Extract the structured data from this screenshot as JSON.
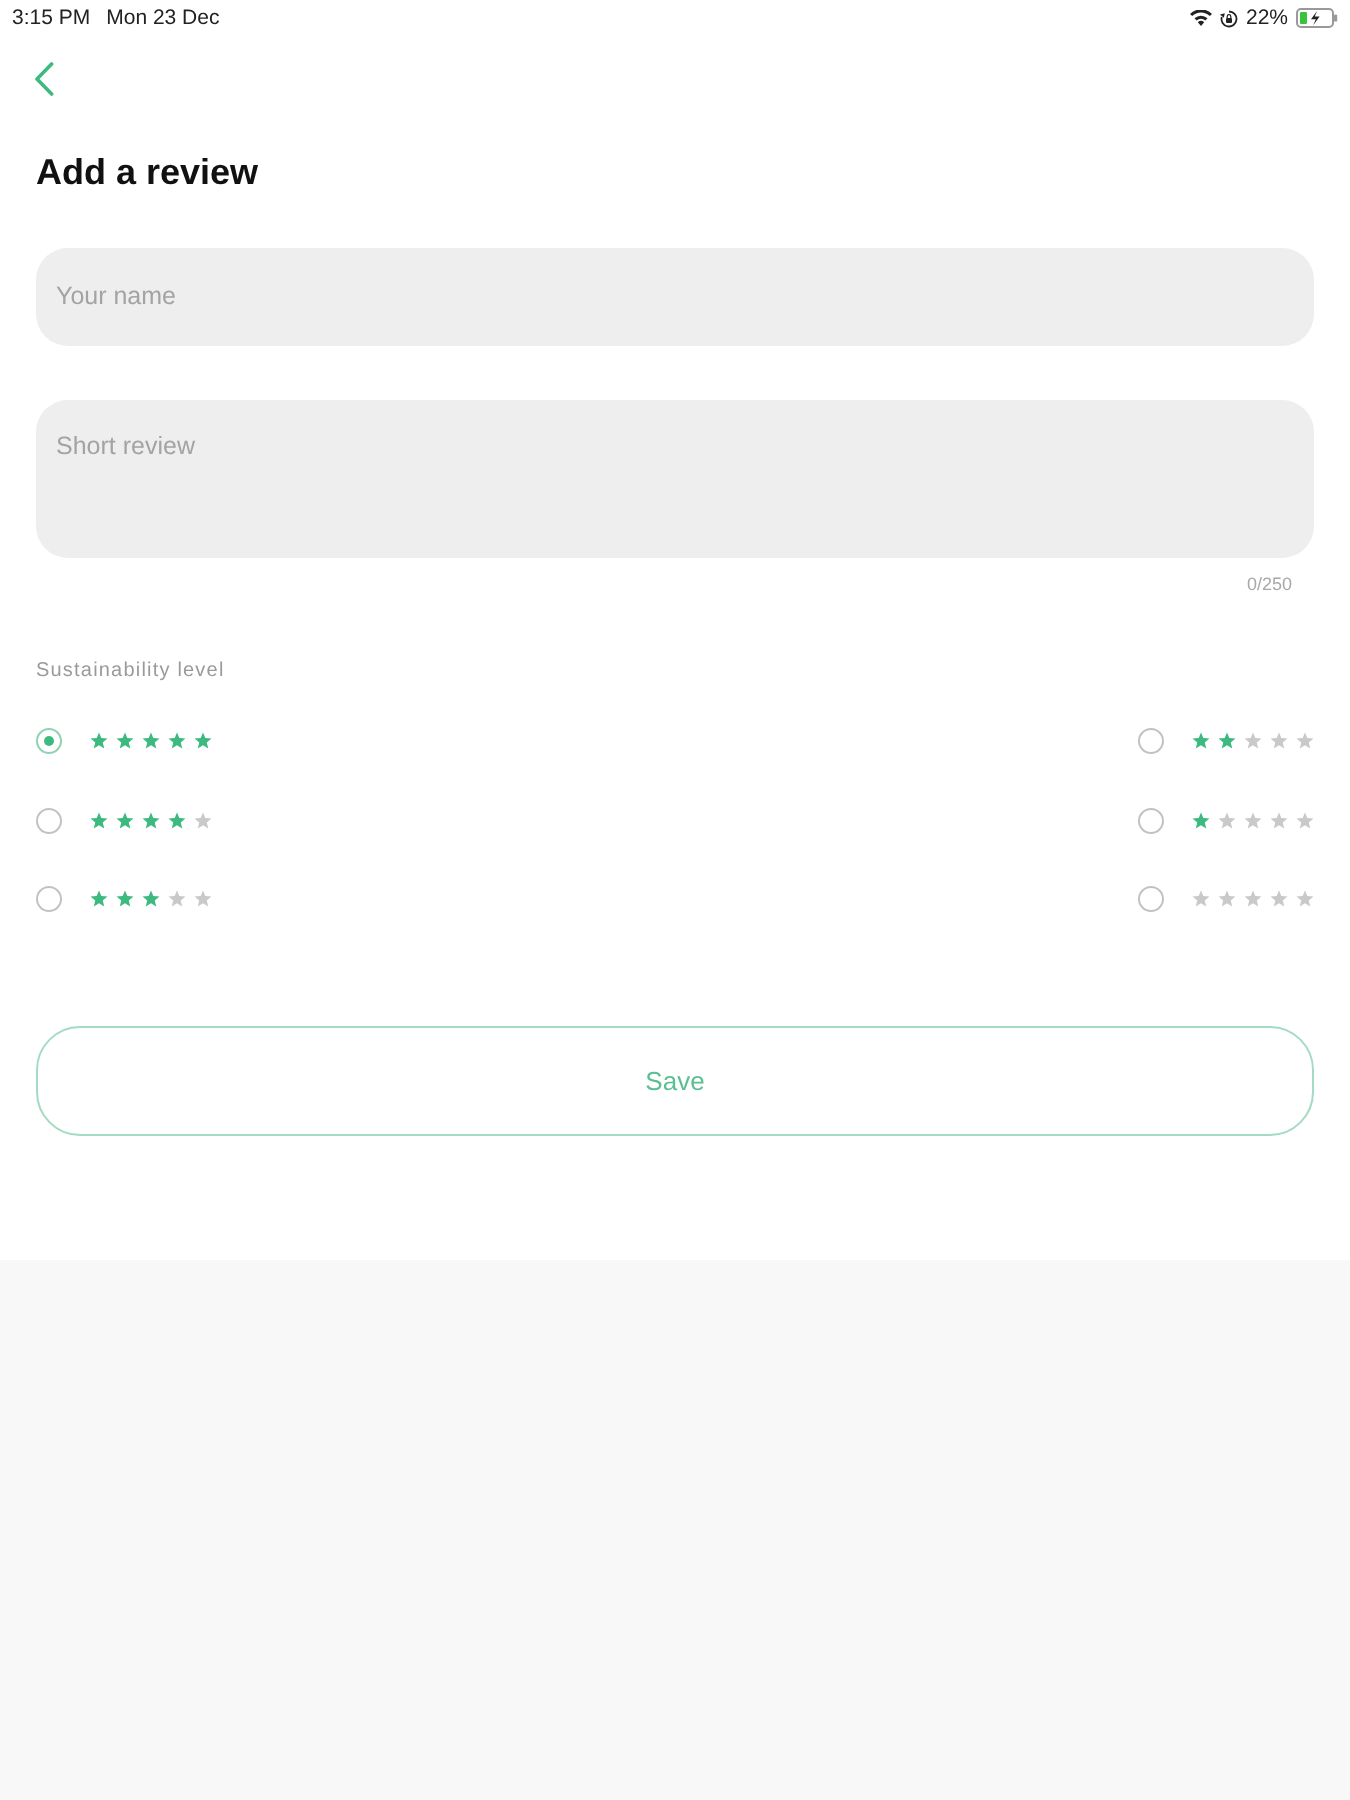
{
  "status_bar": {
    "time": "3:15 PM",
    "date": "Mon 23 Dec",
    "battery": "22%"
  },
  "header": {
    "title": "Add a review"
  },
  "form": {
    "name_field": {
      "placeholder": "Your name"
    },
    "review_field": {
      "placeholder": "Short review",
      "counter": "0/250"
    }
  },
  "rating": {
    "label": "Sustainability level",
    "options": [
      {
        "stars": 5,
        "selected": true
      },
      {
        "stars": 4,
        "selected": false
      },
      {
        "stars": 3,
        "selected": false
      },
      {
        "stars": 2,
        "selected": false
      },
      {
        "stars": 1,
        "selected": false
      },
      {
        "stars": 0,
        "selected": false
      }
    ]
  },
  "save_button": {
    "label": "Save"
  }
}
